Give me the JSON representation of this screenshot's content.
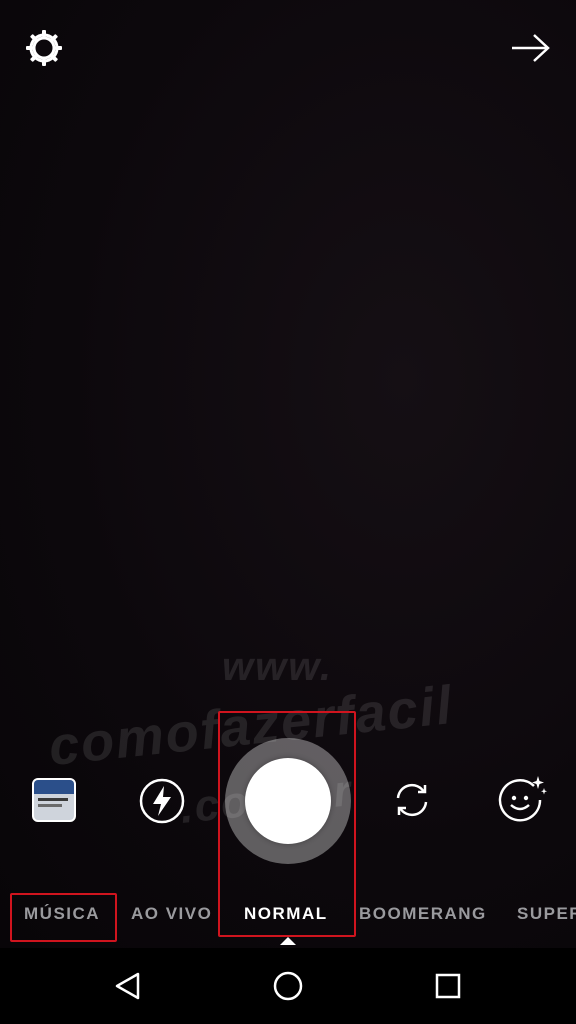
{
  "camera": {
    "settings_icon": "gear-icon",
    "forward_icon": "arrow-right-icon"
  },
  "watermark": {
    "line1": "www.",
    "line2": "comofazerfacil",
    "line3": ".com.br"
  },
  "controls": {
    "gallery_icon": "gallery-thumbnail",
    "flash_icon": "flash-icon",
    "shutter_icon": "shutter-button",
    "flip_icon": "flip-camera-icon",
    "effects_icon": "face-effects-icon"
  },
  "modes": {
    "items": [
      {
        "label": "MÚSICA"
      },
      {
        "label": "AO VIVO"
      },
      {
        "label": "NORMAL"
      },
      {
        "label": "BOOMERANG"
      },
      {
        "label": "SUPER"
      }
    ],
    "active": "NORMAL"
  },
  "annotations": {
    "highlight_color": "#d0141e"
  },
  "navbar": {
    "back_icon": "back-triangle-icon",
    "home_icon": "home-circle-icon",
    "recent_icon": "recent-apps-square-icon"
  }
}
